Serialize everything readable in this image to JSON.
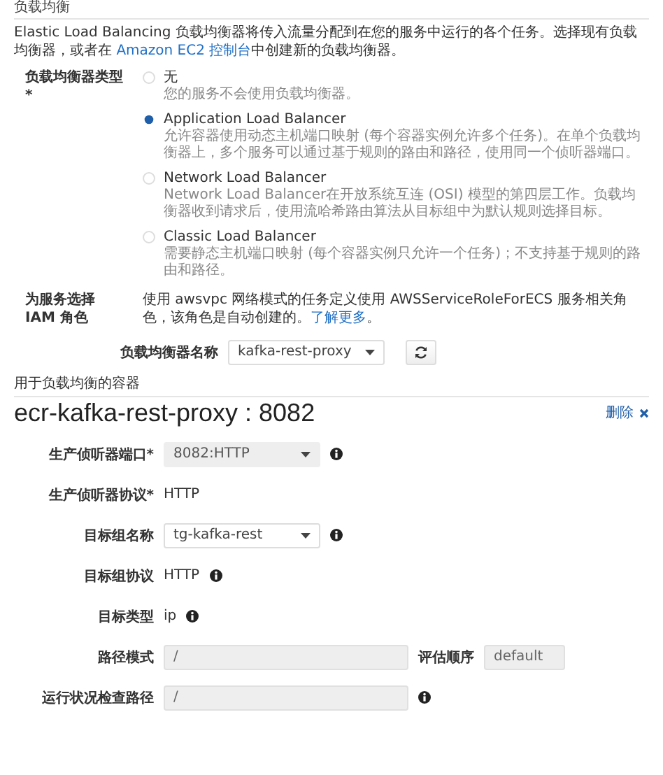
{
  "section_title": "负载均衡",
  "description": {
    "text": "Elastic Load Balancing 负载均衡器将传入流量分配到在您的服务中运行的各个任务。选择现有负载均衡器，或者在 ",
    "link": "Amazon EC2 控制台",
    "text_after": "中创建新的负载均衡器。"
  },
  "lb_type": {
    "label": "负载均衡器类型",
    "required_mark": "*",
    "options": [
      {
        "label": "无",
        "description": "您的服务不会使用负载均衡器。",
        "selected": false
      },
      {
        "label": "Application Load Balancer",
        "description": "允许容器使用动态主机端口映射 (每个容器实例允许多个任务)。在单个负载均衡器上，多个服务可以通过基于规则的路由和路径，使用同一个侦听器端口。",
        "selected": true
      },
      {
        "label": "Network Load Balancer",
        "description": "Network Load Balancer在开放系统互连 (OSI) 模型的第四层工作。负载均衡器收到请求后，使用流哈希路由算法从目标组中为默认规则选择目标。",
        "selected": false
      },
      {
        "label": "Classic Load Balancer",
        "description": "需要静态主机端口映射 (每个容器实例只允许一个任务)；不支持基于规则的路由和路径。",
        "selected": false
      }
    ]
  },
  "iam": {
    "label": "为服务选择 IAM 角色",
    "text": "使用 awsvpc 网络模式的任务定义使用 AWSServiceRoleForECS 服务相关角色，该角色是自动创建的。",
    "link": "了解更多",
    "text_after": "。"
  },
  "lb_name": {
    "label": "负载均衡器名称",
    "value": "kafka-rest-proxy"
  },
  "containers_title": "用于负载均衡的容器",
  "container": {
    "title": "ecr-kafka-rest-proxy : 8082",
    "remove": "删除",
    "fields": [
      {
        "kind": "select",
        "label": "生产侦听器端口*",
        "value": "8082:HTTP",
        "disabled": true,
        "info": true
      },
      {
        "kind": "text",
        "label": "生产侦听器协议*",
        "value": "HTTP",
        "info": false
      },
      {
        "kind": "select",
        "label": "目标组名称",
        "value": "tg-kafka-rest",
        "disabled": false,
        "info": true
      },
      {
        "kind": "text",
        "label": "目标组协议",
        "value": "HTTP",
        "info": true
      },
      {
        "kind": "text",
        "label": "目标类型",
        "value": "ip",
        "info": true
      },
      {
        "kind": "input",
        "label": "路径模式",
        "value": "/",
        "info": false,
        "extra_label": "评估顺序",
        "extra_value": "default"
      },
      {
        "kind": "input",
        "label": "运行状况检查路径",
        "value": "/",
        "info": true
      }
    ]
  }
}
